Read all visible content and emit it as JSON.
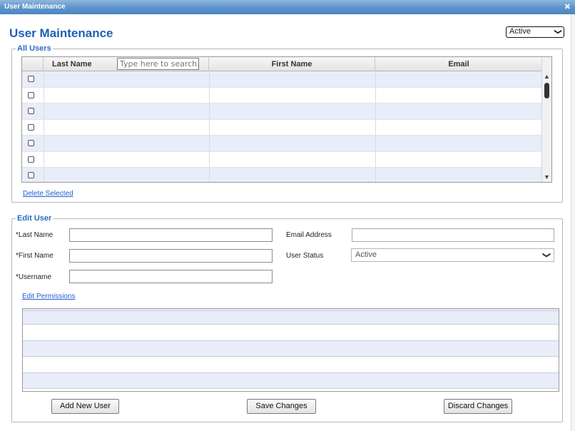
{
  "window": {
    "title": "User Maintenance",
    "close_glyph": "✖"
  },
  "page": {
    "title": "User Maintenance"
  },
  "status_filter": {
    "selected": "Active",
    "chevron": "❯"
  },
  "all_users": {
    "legend": "All Users",
    "columns": [
      "Last Name",
      "First Name",
      "Email"
    ],
    "search_placeholder": "Type here to search...",
    "row_count": 7,
    "delete_link": "Delete Selected"
  },
  "edit_user": {
    "legend": "Edit User",
    "last_name_label": "*Last Name",
    "first_name_label": "*First Name",
    "username_label": "*Username",
    "email_label": "Email Address",
    "status_label": "User Status",
    "status_value": "Active",
    "permissions_link": "Edit Permissions"
  },
  "buttons": {
    "add": "Add New User",
    "save": "Save Changes",
    "discard": "Discard Changes"
  }
}
